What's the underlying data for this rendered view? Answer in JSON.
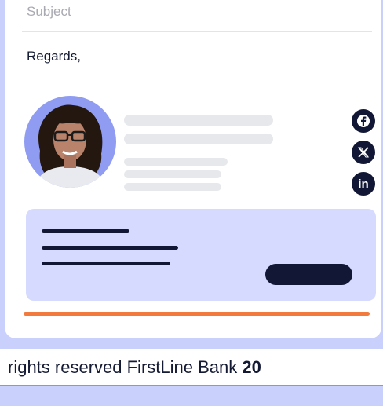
{
  "email": {
    "subject_placeholder": "Subject",
    "closing": "Regards,"
  },
  "signature": {
    "social_icons": [
      {
        "name": "facebook-icon",
        "glyph": "f"
      },
      {
        "name": "x-icon",
        "glyph": "𝕏"
      },
      {
        "name": "linkedin-icon",
        "glyph": "in"
      }
    ]
  },
  "colors": {
    "accent": "#f27a3d",
    "navy": "#111735",
    "promo_bg": "#d6dafe",
    "page_bg": "#c8d0fb"
  },
  "footer": {
    "text_prefix": "rights reserved FirstLine Bank ",
    "text_bold": "20"
  }
}
